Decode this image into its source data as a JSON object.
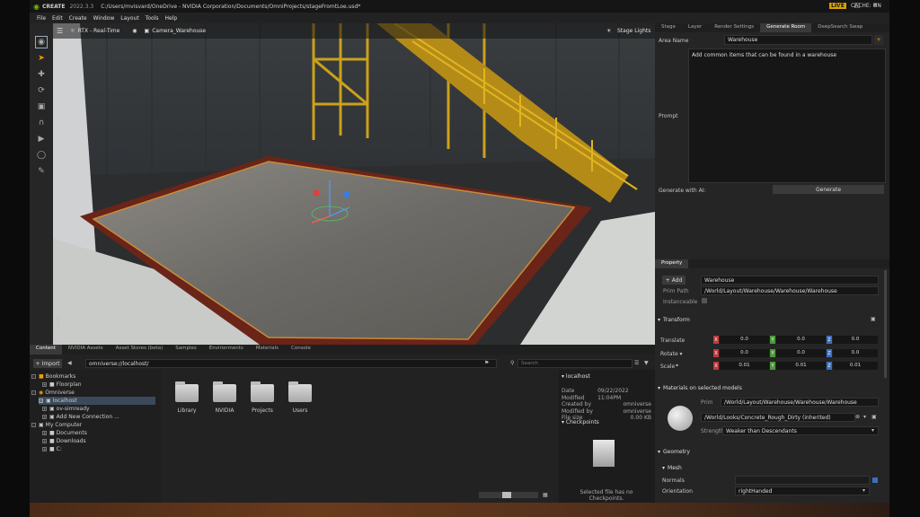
{
  "app": {
    "logo": "CREATE",
    "version": "2022.3.3",
    "path": "C:/Users/mvisvard/OneDrive - NVIDIA Corporation/Documents/OmniProjects/stageFromtLoe.usd*",
    "live": "LIVE",
    "cache": "CACHE: ON"
  },
  "menu": [
    "File",
    "Edit",
    "Create",
    "Window",
    "Layout",
    "Tools",
    "Help"
  ],
  "viewport": {
    "renderer": "RTX - Real-Time",
    "camera": "Camera_Warehouse",
    "lights": "Stage Lights",
    "axis_y": "Y",
    "axis_z": "Z"
  },
  "right_tabs": [
    "Stage",
    "Layer",
    "Render Settings",
    "Generate Room",
    "DeepSearch Swap"
  ],
  "generate": {
    "area_name_label": "Area Name",
    "area_name": "Warehouse",
    "prompt_label": "Prompt",
    "prompt": "Add common items that can be found in a warehouse",
    "gen_label": "Generate with AI:",
    "gen_button": "Generate"
  },
  "property": {
    "tab": "Property",
    "add": "Add",
    "name": "Warehouse",
    "prim_path_label": "Prim Path",
    "prim_path": "/World/Layout/Warehouse/Warehouse/Warehouse",
    "instanceable_label": "Instanceable"
  },
  "transform": {
    "title": "Transform",
    "rows": [
      {
        "label": "Translate",
        "x": "0.0",
        "y": "0.0",
        "z": "0.0"
      },
      {
        "label": "Rotate ▾",
        "x": "0.0",
        "y": "0.0",
        "z": "0.0"
      },
      {
        "label": "Scale",
        "x": "0.01",
        "y": "0.01",
        "z": "0.01"
      }
    ],
    "axes": [
      "X",
      "Y",
      "Z"
    ]
  },
  "materials": {
    "title": "Materials on selected models",
    "prim_label": "Prim",
    "prim": "/World/Layout/Warehouse/Warehouse/Warehouse",
    "material": "/World/Looks/Concrete_Rough_Dirty (inherited)",
    "strength_label": "Strength",
    "strength": "Weaker than Descendants"
  },
  "geometry": {
    "title": "Geometry",
    "mesh": "Mesh",
    "normals_label": "Normals",
    "orientation_label": "Orientation",
    "orientation": "rightHanded"
  },
  "bottom_tabs": [
    "Content",
    "NVIDIA Assets",
    "Asset Stores (beta)",
    "Samples",
    "Environments",
    "Materials",
    "Console"
  ],
  "content": {
    "import": "Import",
    "path": "omniverse://localhost/",
    "search_placeholder": "Search",
    "tree": [
      {
        "label": "Bookmarks",
        "indent": 0
      },
      {
        "label": "Floorplan",
        "indent": 1
      },
      {
        "label": "Omniverse",
        "indent": 0
      },
      {
        "label": "localhost",
        "indent": 1,
        "selected": true
      },
      {
        "label": "ov-simready",
        "indent": 1
      },
      {
        "label": "Add New Connection ...",
        "indent": 1
      },
      {
        "label": "My Computer",
        "indent": 0
      },
      {
        "label": "Documents",
        "indent": 1
      },
      {
        "label": "Downloads",
        "indent": 1
      },
      {
        "label": "C:",
        "indent": 1
      }
    ],
    "folders": [
      "Library",
      "NVIDIA",
      "Projects",
      "Users"
    ]
  },
  "info": {
    "title": "localhost",
    "date_label": "Date Modified",
    "date": "09/22/2022 11:04PM",
    "created_label": "Created by",
    "created": "omniverse",
    "modified_label": "Modified by",
    "modified": "omniverse",
    "size_label": "File size",
    "size": "0.00 KB",
    "checkpoints": "Checkpoints",
    "note": "Selected file has no Checkpoints."
  }
}
